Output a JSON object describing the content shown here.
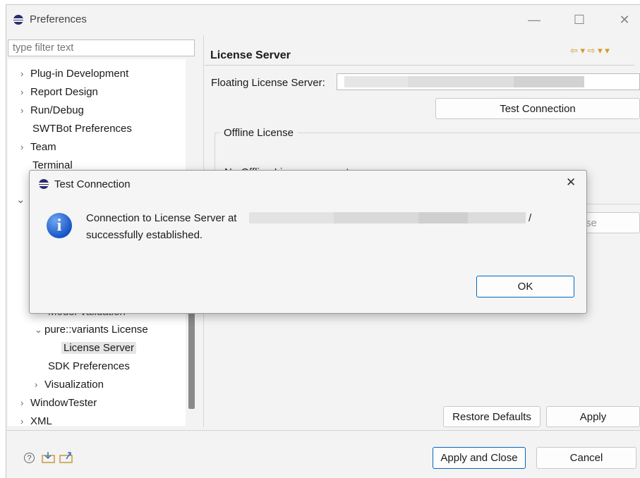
{
  "window": {
    "title": "Preferences",
    "minimize_glyph": "—",
    "maximize_glyph": "☐",
    "close_glyph": "✕"
  },
  "sidebar": {
    "filter_placeholder": "type filter text",
    "items": [
      {
        "label": "Plug-in Development",
        "expander": "›"
      },
      {
        "label": "Report Design",
        "expander": "›"
      },
      {
        "label": "Run/Debug",
        "expander": "›"
      },
      {
        "label": "SWTBot Preferences",
        "expander": ""
      },
      {
        "label": "Team",
        "expander": "›"
      },
      {
        "label": "Terminal",
        "expander": ""
      },
      {
        "label": "Model Validation",
        "expander": ""
      },
      {
        "label": "pure::variants License",
        "expander": "⌄"
      },
      {
        "label": "License Server",
        "expander": ""
      },
      {
        "label": "SDK Preferences",
        "expander": ""
      },
      {
        "label": "Visualization",
        "expander": "›"
      },
      {
        "label": "WindowTester",
        "expander": "›"
      },
      {
        "label": "XML",
        "expander": "›"
      }
    ]
  },
  "page": {
    "title": "License Server",
    "floating_label": "Floating License Server:",
    "test_connection_label": "Test Connection",
    "offline_group_label": "Offline License",
    "offline_status": "No Offline License present",
    "partial_button_text": "se",
    "restore_defaults_label": "Restore Defaults",
    "apply_label": "Apply",
    "nav_arrows": "⇦ ▾ ⇨ ▾ ▾"
  },
  "footer": {
    "apply_close_label": "Apply and Close",
    "cancel_label": "Cancel",
    "help_glyph": "?"
  },
  "dialog": {
    "title": "Test Connection",
    "close_glyph": "✕",
    "message_line1": "Connection to License Server at",
    "message_line1_suffix": "/",
    "message_line2": "successfully established.",
    "ok_label": "OK",
    "icon_glyph": "i"
  },
  "colors": {
    "accent": "#0067c0",
    "selection": "#e5e5e5",
    "window_bg": "#f3f3f3"
  }
}
